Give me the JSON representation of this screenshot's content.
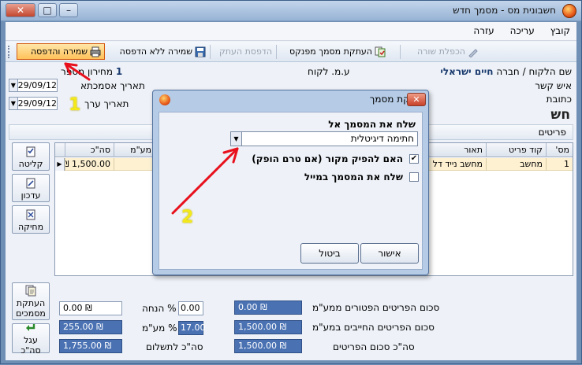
{
  "window": {
    "title": "חשבונית מס - מסמך חדש",
    "buttons": {
      "minimize": "–",
      "maximize": "□",
      "close": "✕"
    }
  },
  "menu": [
    "קובץ",
    "עריכה",
    "עזרה"
  ],
  "toolbar": {
    "print_save": "שמירה והדפסה",
    "save_no_print": "שמירה ללא הדפסה",
    "print_copy": "הדפסת העתק",
    "copy_from_ledger": "העתקת מסמך מפנקס",
    "duplicate_row": "הכפלת שורה"
  },
  "header": {
    "customer_name_label": "שם הלקוח / חברה",
    "customer_name_value": "חיים ישראלי",
    "contact_label": "איש קשר",
    "address_label": "כתובת",
    "vat_id_label": "ע.מ. לקוח",
    "pricelist_label": "מחירון מספר",
    "pricelist_value": "1",
    "ref_date_label": "תאריך אסמכתא",
    "ref_date_value": "29/09/12",
    "value_date_label": "תאריך ערך",
    "value_date_value": "29/09/12",
    "doc_header_fragment": "חש"
  },
  "items": {
    "bar_label": "פריטים",
    "columns": [
      "מס'",
      "קוד פריט",
      "תאור",
      "מע\"מ",
      "סה\"כ"
    ],
    "rows": [
      {
        "num": "1",
        "code": "מחשב",
        "desc": "מחשב נייד דל",
        "total": "1,500.00 ₪"
      }
    ]
  },
  "side_buttons": {
    "receive": "קליטה",
    "update": "עדכון",
    "delete": "מחיקה",
    "copy_docs": "העתקת מסמכים",
    "round_total": "עגל סה\"כ"
  },
  "totals": {
    "exempt_label": "סכום הפריטים הפטורים ממע\"מ",
    "exempt_value": "0.00 ₪",
    "taxable_label": "סכום הפריטים החייבים במע\"מ",
    "taxable_value": "1,500.00 ₪",
    "items_total_label": "סה\"כ סכום הפריטים",
    "items_total_value": "1,500.00 ₪",
    "discount_label": "% הנחה",
    "discount_pct": "0.00",
    "discount_value": "0.00 ₪",
    "vat_label": "% מע\"מ",
    "vat_pct": "17.00",
    "vat_value": "255.00 ₪",
    "payable_label": "סה\"כ לתשלום",
    "payable_value": "1,755.00 ₪"
  },
  "dialog": {
    "title": "הפקת מסמך",
    "send_label": "שלח את המסמך אל",
    "send_value": "חתימה דיגיטלית",
    "close": "✕",
    "opt_original": "האם להפיק מקור (אם טרם הופק)",
    "opt_original_checked": "✔",
    "opt_email": "שלח את המסמך במייל",
    "ok": "אישור",
    "cancel": "ביטול"
  },
  "annotations": {
    "step1": "1",
    "step2": "2",
    "arrow_color": "#e8101c",
    "number_color": "#f2e81a"
  },
  "colors": {
    "accent_blue": "#4a72b3",
    "row_highlight": "#fdf1d2",
    "print_button": "#ffc25a"
  }
}
